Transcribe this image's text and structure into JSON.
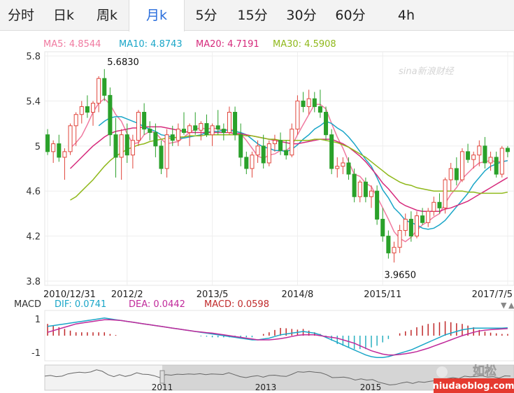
{
  "tabs": [
    {
      "label": "分时"
    },
    {
      "label": "日k"
    },
    {
      "label": "周k"
    },
    {
      "label": "月k"
    },
    {
      "label": "5分"
    },
    {
      "label": "15分"
    },
    {
      "label": "30分"
    },
    {
      "label": "60分"
    },
    {
      "label": "4h"
    }
  ],
  "active_tab_index": 3,
  "ma_legend": [
    {
      "label": "MA5: 4.8544",
      "color": "#f07aa0"
    },
    {
      "label": "MA10: 4.8743",
      "color": "#1aa6c8"
    },
    {
      "label": "MA20: 4.7191",
      "color": "#d62a7c"
    },
    {
      "label": "MA30: 4.5908",
      "color": "#8fb81a"
    }
  ],
  "watermark": "sina新浪财经",
  "macd_legend": {
    "title": "MACD",
    "dif": "DIF: 0.0741",
    "dea": "DEA: 0.0442",
    "macd": "MACD: 0.0598",
    "dif_color": "#1aa6c8",
    "dea_color": "#c0299a",
    "macd_color": "#c0292a"
  },
  "navigator_years": [
    "2011",
    "2013",
    "2015"
  ],
  "site_watermark": "niudaoblog.com",
  "wechat_label": "如松",
  "chart_data": {
    "type": "candlestick",
    "ylim": [
      3.8,
      5.8
    ],
    "yticks": [
      "5.8",
      "5.4",
      "5",
      "4.6",
      "4.2",
      "3.8"
    ],
    "xticks": [
      "2010/12/31",
      "2012/2",
      "2013/5",
      "2014/8",
      "2015/11",
      "2017/7/5"
    ],
    "max_label": "5.6830",
    "min_label": "3.9650",
    "up_color": "#e0453b",
    "down_color": "#2aa12a",
    "candles": [
      [
        5.1,
        5.15,
        4.92,
        4.95
      ],
      [
        4.95,
        5.05,
        4.85,
        5.02
      ],
      [
        5.02,
        5.1,
        4.86,
        4.9
      ],
      [
        4.9,
        4.98,
        4.7,
        4.95
      ],
      [
        4.95,
        5.2,
        4.92,
        5.18
      ],
      [
        5.18,
        5.3,
        5.0,
        5.28
      ],
      [
        5.28,
        5.4,
        5.2,
        5.35
      ],
      [
        5.35,
        5.45,
        5.25,
        5.3
      ],
      [
        5.3,
        5.4,
        5.18,
        5.38
      ],
      [
        5.38,
        5.62,
        5.3,
        5.6
      ],
      [
        5.6,
        5.683,
        5.4,
        5.45
      ],
      [
        5.45,
        5.52,
        5.0,
        5.1
      ],
      [
        5.1,
        5.25,
        4.72,
        4.9
      ],
      [
        4.9,
        5.15,
        4.7,
        5.1
      ],
      [
        5.1,
        5.2,
        4.85,
        4.92
      ],
      [
        4.92,
        5.1,
        4.8,
        5.05
      ],
      [
        5.05,
        5.32,
        5.0,
        5.3
      ],
      [
        5.3,
        5.38,
        5.1,
        5.15
      ],
      [
        5.15,
        5.22,
        5.05,
        5.12
      ],
      [
        5.12,
        5.2,
        4.9,
        5.0
      ],
      [
        5.0,
        5.05,
        4.75,
        4.8
      ],
      [
        4.8,
        5.15,
        4.72,
        5.1
      ],
      [
        5.1,
        5.18,
        5.0,
        5.05
      ],
      [
        5.05,
        5.2,
        5.0,
        5.15
      ],
      [
        5.15,
        5.3,
        5.1,
        5.12
      ],
      [
        5.12,
        5.2,
        5.0,
        5.18
      ],
      [
        5.18,
        5.3,
        5.1,
        5.14
      ],
      [
        5.14,
        5.22,
        5.05,
        5.2
      ],
      [
        5.2,
        5.28,
        5.08,
        5.1
      ],
      [
        5.1,
        5.2,
        5.0,
        5.18
      ],
      [
        5.18,
        5.32,
        5.1,
        5.15
      ],
      [
        5.15,
        5.2,
        5.05,
        5.12
      ],
      [
        5.12,
        5.35,
        5.1,
        5.3
      ],
      [
        5.3,
        5.35,
        5.05,
        5.1
      ],
      [
        5.1,
        5.2,
        4.82,
        4.9
      ],
      [
        4.9,
        4.95,
        4.75,
        4.8
      ],
      [
        4.8,
        4.95,
        4.72,
        4.92
      ],
      [
        4.92,
        5.05,
        4.85,
        5.0
      ],
      [
        5.0,
        5.1,
        4.8,
        4.85
      ],
      [
        4.85,
        5.05,
        4.82,
        5.02
      ],
      [
        5.02,
        5.1,
        4.95,
        5.05
      ],
      [
        5.05,
        5.12,
        4.92,
        4.96
      ],
      [
        4.96,
        5.05,
        4.88,
        4.92
      ],
      [
        4.92,
        5.2,
        4.9,
        5.15
      ],
      [
        5.15,
        5.45,
        5.1,
        5.4
      ],
      [
        5.4,
        5.48,
        5.3,
        5.35
      ],
      [
        5.35,
        5.5,
        5.28,
        5.42
      ],
      [
        5.42,
        5.48,
        5.3,
        5.35
      ],
      [
        5.35,
        5.5,
        5.25,
        5.3
      ],
      [
        5.3,
        5.35,
        5.05,
        5.1
      ],
      [
        5.1,
        5.15,
        4.75,
        4.8
      ],
      [
        4.8,
        4.9,
        4.72,
        4.82
      ],
      [
        4.82,
        4.9,
        4.75,
        4.85
      ],
      [
        4.85,
        4.9,
        4.7,
        4.75
      ],
      [
        4.75,
        4.8,
        4.5,
        4.55
      ],
      [
        4.55,
        4.7,
        4.5,
        4.68
      ],
      [
        4.68,
        4.72,
        4.5,
        4.55
      ],
      [
        4.55,
        4.65,
        4.45,
        4.6
      ],
      [
        4.6,
        4.65,
        4.3,
        4.35
      ],
      [
        4.35,
        4.45,
        4.15,
        4.2
      ],
      [
        4.2,
        4.25,
        4.0,
        4.05
      ],
      [
        4.05,
        4.15,
        3.965,
        4.1
      ],
      [
        4.1,
        4.3,
        4.05,
        4.25
      ],
      [
        4.25,
        4.4,
        4.2,
        4.35
      ],
      [
        4.35,
        4.42,
        4.15,
        4.2
      ],
      [
        4.2,
        4.42,
        4.18,
        4.38
      ],
      [
        4.38,
        4.45,
        4.3,
        4.32
      ],
      [
        4.32,
        4.45,
        4.28,
        4.42
      ],
      [
        4.42,
        4.55,
        4.38,
        4.5
      ],
      [
        4.5,
        4.58,
        4.4,
        4.45
      ],
      [
        4.45,
        4.72,
        4.4,
        4.7
      ],
      [
        4.7,
        4.85,
        4.6,
        4.8
      ],
      [
        4.8,
        4.9,
        4.65,
        4.7
      ],
      [
        4.7,
        4.98,
        4.68,
        4.95
      ],
      [
        4.95,
        5.02,
        4.85,
        4.88
      ],
      [
        4.88,
        4.95,
        4.8,
        4.92
      ],
      [
        4.92,
        5.05,
        4.82,
        5.0
      ],
      [
        5.0,
        5.08,
        4.8,
        4.85
      ],
      [
        4.85,
        4.95,
        4.78,
        4.9
      ],
      [
        4.9,
        4.95,
        4.72,
        4.75
      ],
      [
        4.75,
        5.0,
        4.72,
        4.98
      ],
      [
        4.98,
        5.0,
        4.9,
        4.95
      ]
    ],
    "ma_lines": [
      {
        "name": "MA5",
        "values": [
          null,
          null,
          null,
          null,
          4.98,
          5.03,
          5.09,
          5.19,
          5.3,
          5.38,
          5.42,
          5.37,
          5.28,
          5.22,
          5.11,
          5.02,
          5.03,
          5.1,
          5.13,
          5.12,
          5.06,
          5.02,
          5.03,
          5.04,
          5.08,
          5.12,
          5.15,
          5.16,
          5.15,
          5.16,
          5.15,
          5.14,
          5.15,
          5.14,
          5.11,
          5.05,
          4.98,
          4.91,
          4.89,
          4.92,
          4.93,
          4.96,
          4.96,
          5.0,
          5.1,
          5.19,
          5.28,
          5.37,
          5.37,
          5.33,
          5.2,
          5.08,
          4.98,
          4.86,
          4.75,
          4.73,
          4.67,
          4.64,
          4.55,
          4.45,
          4.35,
          4.24,
          4.18,
          4.15,
          4.19,
          4.25,
          4.3,
          4.33,
          4.37,
          4.4,
          4.49,
          4.57,
          4.63,
          4.71,
          4.76,
          4.81,
          4.85,
          4.86,
          4.87,
          4.86,
          4.86,
          4.87
        ]
      },
      {
        "name": "MA10",
        "values": [
          null,
          null,
          null,
          null,
          null,
          null,
          null,
          null,
          null,
          5.18,
          5.22,
          5.25,
          5.26,
          5.26,
          5.24,
          5.22,
          5.2,
          5.17,
          5.15,
          5.13,
          5.1,
          5.09,
          5.08,
          5.07,
          5.07,
          5.08,
          5.09,
          5.1,
          5.12,
          5.13,
          5.13,
          5.14,
          5.14,
          5.13,
          5.12,
          5.1,
          5.06,
          5.02,
          4.99,
          4.98,
          4.96,
          4.96,
          4.95,
          4.97,
          5.01,
          5.06,
          5.1,
          5.15,
          5.18,
          5.22,
          5.2,
          5.16,
          5.13,
          5.08,
          5.02,
          4.95,
          4.88,
          4.82,
          4.72,
          4.61,
          4.54,
          4.45,
          4.4,
          4.34,
          4.32,
          4.3,
          4.27,
          4.26,
          4.27,
          4.3,
          4.34,
          4.4,
          4.46,
          4.52,
          4.58,
          4.66,
          4.72,
          4.78,
          4.82,
          4.84,
          4.86,
          4.87
        ]
      },
      {
        "name": "MA20",
        "values": [
          null,
          null,
          null,
          null,
          4.8,
          4.85,
          4.9,
          4.95,
          5.0,
          5.04,
          5.08,
          5.11,
          5.13,
          5.14,
          5.15,
          5.16,
          5.16,
          5.17,
          5.17,
          5.17,
          5.17,
          5.16,
          5.15,
          5.14,
          5.13,
          5.12,
          5.12,
          5.12,
          5.12,
          5.12,
          5.12,
          5.12,
          5.12,
          5.11,
          5.11,
          5.1,
          5.09,
          5.08,
          5.07,
          5.06,
          5.05,
          5.04,
          5.03,
          5.02,
          5.02,
          5.03,
          5.04,
          5.05,
          5.06,
          5.06,
          5.06,
          5.04,
          5.02,
          4.99,
          4.95,
          4.91,
          4.86,
          4.8,
          4.74,
          4.67,
          4.62,
          4.56,
          4.5,
          4.47,
          4.45,
          4.43,
          4.42,
          4.42,
          4.42,
          4.42,
          4.44,
          4.45,
          4.47,
          4.49,
          4.51,
          4.54,
          4.57,
          4.6,
          4.63,
          4.66,
          4.69,
          4.72
        ]
      },
      {
        "name": "MA30",
        "values": [
          null,
          null,
          null,
          null,
          4.52,
          4.55,
          4.6,
          4.65,
          4.7,
          4.76,
          4.82,
          4.87,
          4.91,
          4.94,
          4.97,
          4.99,
          5.01,
          5.02,
          5.04,
          5.05,
          5.06,
          5.07,
          5.07,
          5.08,
          5.08,
          5.09,
          5.09,
          5.09,
          5.1,
          5.1,
          5.1,
          5.1,
          5.1,
          5.1,
          5.1,
          5.09,
          5.09,
          5.08,
          5.07,
          5.06,
          5.06,
          5.05,
          5.05,
          5.05,
          5.05,
          5.05,
          5.05,
          5.06,
          5.06,
          5.05,
          5.04,
          5.03,
          5.01,
          4.99,
          4.96,
          4.93,
          4.9,
          4.86,
          4.82,
          4.78,
          4.74,
          4.71,
          4.68,
          4.66,
          4.65,
          4.63,
          4.62,
          4.61,
          4.6,
          4.6,
          4.6,
          4.6,
          4.6,
          4.6,
          4.59,
          4.59,
          4.58,
          4.58,
          4.58,
          4.58,
          4.58,
          4.59
        ]
      }
    ],
    "macd_yticks": [
      "1",
      "-1"
    ],
    "macd_ylim": [
      -1.5,
      1.5
    ],
    "dif": [
      0.55,
      0.6,
      0.65,
      0.7,
      0.75,
      0.8,
      0.85,
      0.9,
      0.95,
      1.0,
      1.05,
      1.0,
      0.95,
      0.9,
      0.85,
      0.8,
      0.75,
      0.7,
      0.65,
      0.6,
      0.55,
      0.5,
      0.45,
      0.4,
      0.35,
      0.3,
      0.25,
      0.2,
      0.15,
      0.1,
      0.05,
      0.0,
      -0.05,
      -0.1,
      -0.15,
      -0.2,
      -0.25,
      -0.25,
      -0.2,
      -0.15,
      -0.05,
      0.05,
      0.1,
      0.15,
      0.2,
      0.25,
      0.2,
      0.15,
      0.05,
      -0.1,
      -0.25,
      -0.4,
      -0.55,
      -0.7,
      -0.85,
      -1.0,
      -1.15,
      -1.25,
      -1.3,
      -1.3,
      -1.25,
      -1.15,
      -1.05,
      -0.95,
      -0.85,
      -0.7,
      -0.55,
      -0.4,
      -0.25,
      -0.1,
      0.05,
      0.15,
      0.25,
      0.35,
      0.4,
      0.45,
      0.45,
      0.45,
      0.45,
      0.45,
      0.45,
      0.47
    ],
    "dea": [
      0.2,
      0.3,
      0.4,
      0.5,
      0.6,
      0.7,
      0.75,
      0.8,
      0.85,
      0.9,
      0.95,
      0.95,
      0.93,
      0.9,
      0.85,
      0.8,
      0.75,
      0.7,
      0.65,
      0.6,
      0.55,
      0.5,
      0.45,
      0.4,
      0.35,
      0.3,
      0.25,
      0.22,
      0.18,
      0.15,
      0.1,
      0.05,
      0.0,
      -0.05,
      -0.1,
      -0.15,
      -0.2,
      -0.25,
      -0.25,
      -0.25,
      -0.22,
      -0.18,
      -0.12,
      -0.05,
      0.02,
      0.05,
      0.05,
      0.05,
      0.0,
      -0.05,
      -0.1,
      -0.15,
      -0.25,
      -0.35,
      -0.45,
      -0.6,
      -0.75,
      -0.9,
      -1.0,
      -1.1,
      -1.15,
      -1.15,
      -1.12,
      -1.08,
      -1.02,
      -0.95,
      -0.85,
      -0.75,
      -0.62,
      -0.5,
      -0.38,
      -0.25,
      -0.12,
      0.0,
      0.1,
      0.2,
      0.28,
      0.33,
      0.36,
      0.38,
      0.4,
      0.42
    ]
  }
}
